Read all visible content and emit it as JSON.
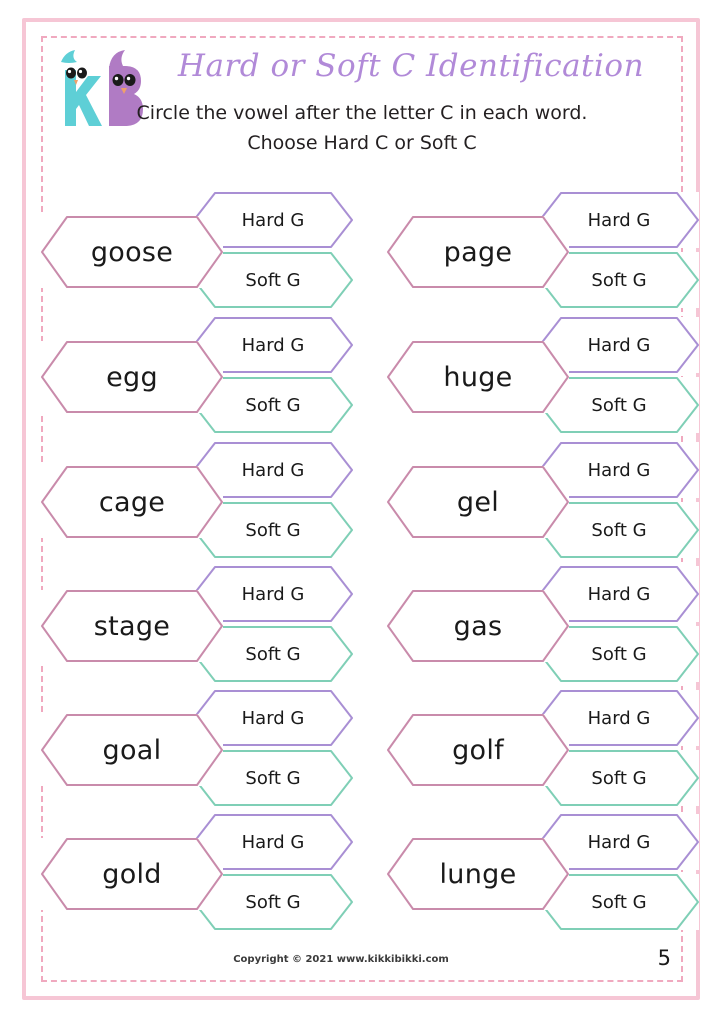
{
  "page": {
    "title": "Hard or Soft C Identification",
    "subtitle_line1": "Circle the vowel after the letter C in each word.",
    "subtitle_line2": "Choose Hard C or Soft C",
    "page_number": "5",
    "copyright": "Copyright © 2021 www.kikkibikki.com"
  },
  "logo": {
    "letter_k": "K",
    "letter_b": "B",
    "color_k": "#5ecfd6",
    "color_b": "#b07bc4"
  },
  "colors": {
    "frame_pink": "#f6c6d5",
    "dashed_pink": "#f0a9bf",
    "title_purple": "#b18ad8",
    "word_border": "#c98bab",
    "hard_border": "#a98fd4",
    "soft_border": "#7fcfb6",
    "text_black": "#1a1a1a"
  },
  "options": {
    "hard_label": "Hard G",
    "soft_label": "Soft G"
  },
  "items": [
    {
      "word": "goose",
      "hard": "Hard G",
      "soft": "Soft G"
    },
    {
      "word": "page",
      "hard": "Hard G",
      "soft": "Soft G"
    },
    {
      "word": "egg",
      "hard": "Hard G",
      "soft": "Soft G"
    },
    {
      "word": "huge",
      "hard": "Hard G",
      "soft": "Soft G"
    },
    {
      "word": "cage",
      "hard": "Hard G",
      "soft": "Soft G"
    },
    {
      "word": "gel",
      "hard": "Hard G",
      "soft": "Soft G"
    },
    {
      "word": "stage",
      "hard": "Hard G",
      "soft": "Soft G"
    },
    {
      "word": "gas",
      "hard": "Hard G",
      "soft": "Soft G"
    },
    {
      "word": "goal",
      "hard": "Hard G",
      "soft": "Soft G"
    },
    {
      "word": "golf",
      "hard": "Hard G",
      "soft": "Soft G"
    },
    {
      "word": "gold",
      "hard": "Hard G",
      "soft": "Soft G"
    },
    {
      "word": "lunge",
      "hard": "Hard G",
      "soft": "Soft G"
    }
  ]
}
